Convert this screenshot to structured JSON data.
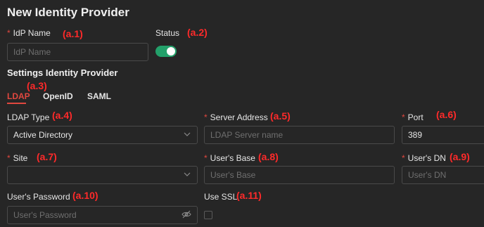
{
  "form": {
    "title": "New Identity Provider",
    "idp_name": {
      "label": "IdP Name",
      "placeholder": "IdP Name",
      "annotation": "(a.1)"
    },
    "status": {
      "label": "Status",
      "annotation": "(a.2)",
      "enabled": true
    }
  },
  "settings": {
    "title": "Settings Identity Provider",
    "tabs": [
      {
        "label": "LDAP",
        "active": true
      },
      {
        "label": "OpenID",
        "active": false
      },
      {
        "label": "SAML",
        "active": false
      }
    ],
    "tabs_annotation": "(a.3)",
    "ldap_type": {
      "label": "LDAP Type",
      "value": "Active Directory",
      "annotation": "(a.4)"
    },
    "server_address": {
      "label": "Server Address",
      "placeholder": "LDAP Server name",
      "annotation": "(a.5)"
    },
    "port": {
      "label": "Port",
      "value": "389",
      "annotation": "(a.6)"
    },
    "site": {
      "label": "Site",
      "value": "",
      "annotation": "(a.7)"
    },
    "users_base": {
      "label": "User's Base",
      "placeholder": "User's Base",
      "annotation": "(a.8)"
    },
    "users_dn": {
      "label": "User's DN",
      "placeholder": "User's DN",
      "annotation": "(a.9)"
    },
    "users_password": {
      "label": "User's Password",
      "placeholder": "User's Password",
      "annotation": "(a.10)"
    },
    "use_ssl": {
      "label": "Use SSL",
      "annotation": "(a.11)",
      "checked": false
    }
  },
  "colors": {
    "accent": "#e0473f",
    "toggle_on": "#23a06a",
    "annotation": "#ff2a2a",
    "background": "#262626"
  },
  "icons": {
    "chevron": "chevron-down-icon",
    "eye": "eye-off-icon"
  }
}
